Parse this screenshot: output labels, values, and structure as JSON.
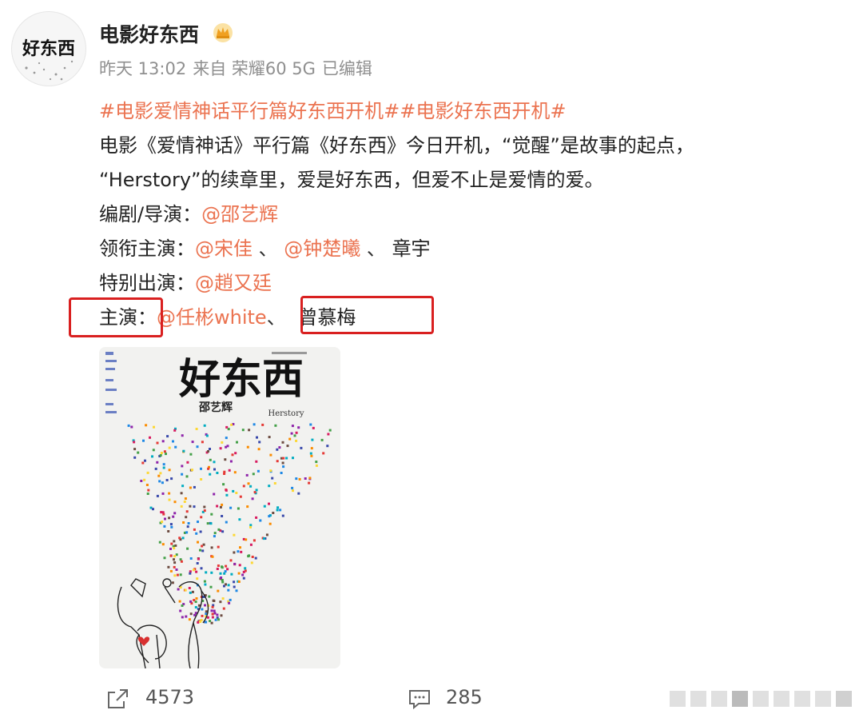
{
  "user": {
    "name": "电影好东西",
    "avatar_text": "好东西",
    "badge_icon": "crown-icon",
    "time": "昨天 13:02",
    "source": "来自 荣耀60 5G",
    "edited": "已编辑"
  },
  "post": {
    "hashtags": "#电影爱情神话平行篇好东西开机##电影好东西开机#",
    "description_line1": "电影《爱情神话》平行篇《好东西》今日开机，“觉醒”是故事的起点，",
    "description_line2": "“Herstory”的续章里，爱是好东西，但爱不止是爱情的爱。",
    "writer_director_label": "编剧/导演：",
    "writer_director": "@邵艺辉",
    "leads_label": "领衔主演：",
    "lead_1": "@宋佳",
    "lead_2": "@钟楚曦",
    "lead_3": "章宇",
    "separator": "、",
    "special_label": "特别出演：",
    "special_1": "@趙又廷",
    "cast_label": "主演：",
    "cast_1": "@任彬white",
    "cast_2": "曾慕梅"
  },
  "poster": {
    "title": "好东西",
    "director_credit": "邵艺辉",
    "subtitle": "Herstory"
  },
  "footer": {
    "repost_icon": "share-icon",
    "repost_count": "4573",
    "comment_icon": "comment-icon",
    "comment_count": "285"
  },
  "colors": {
    "link": "#eb7350",
    "highlight_box": "#d92020",
    "meta": "#8f8f8f"
  }
}
